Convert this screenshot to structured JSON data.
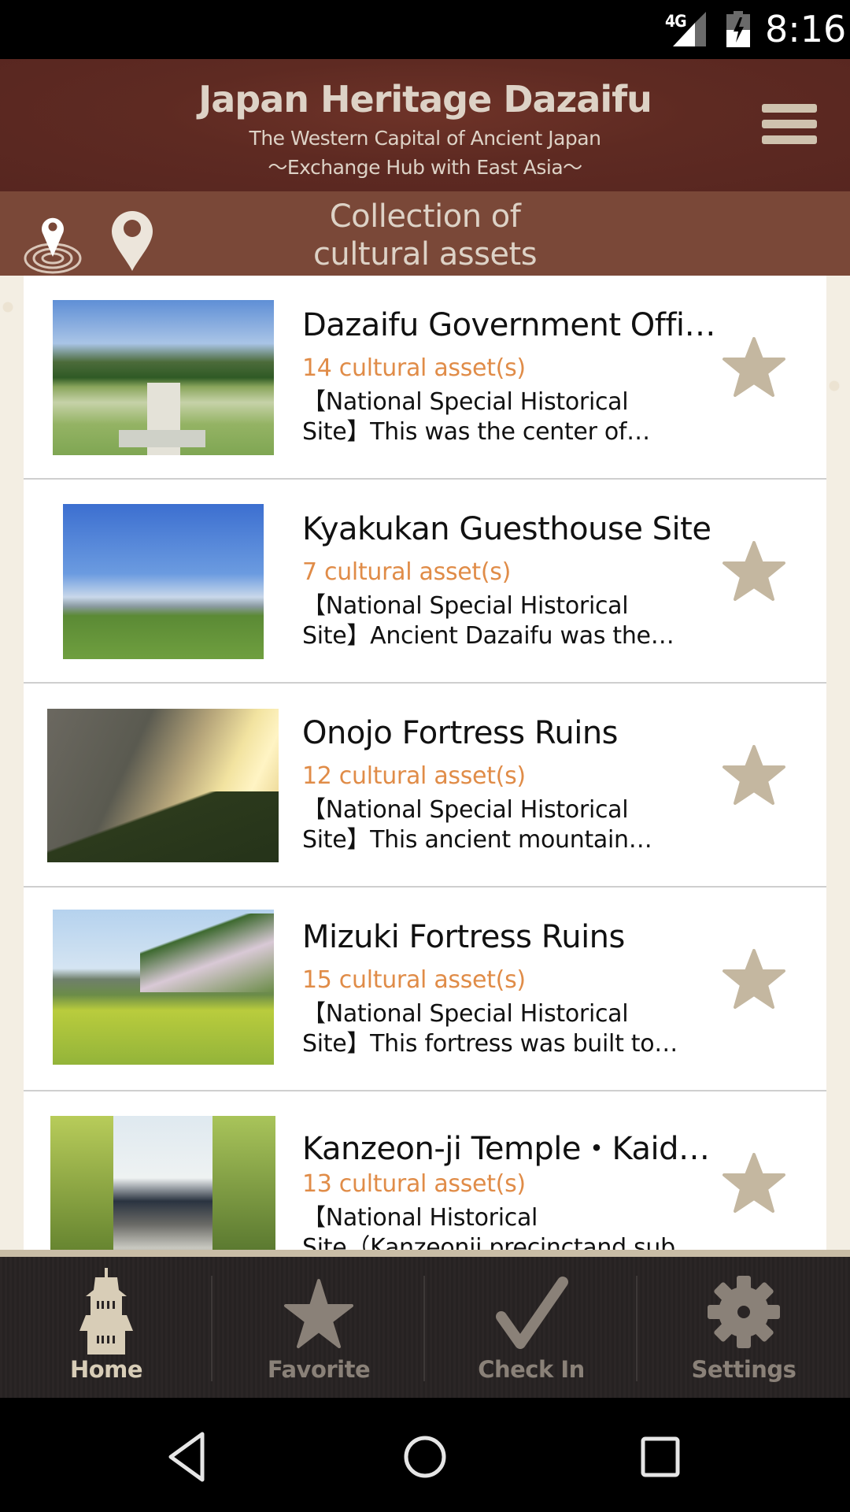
{
  "status_bar": {
    "network": "4G",
    "time": "8:16",
    "icons": [
      "signal-icon",
      "battery-charging-icon"
    ]
  },
  "header": {
    "title": "Japan Heritage Dazaifu",
    "subtitle_line1": "The Western Capital of Ancient Japan",
    "subtitle_line2": "〜Exchange Hub with East Asia〜",
    "menu_icon": "hamburger-menu-icon"
  },
  "sub_header": {
    "caption_line1": "Collection of",
    "caption_line2": "cultural assets",
    "left_icons": [
      "nearby-location-icon",
      "map-pin-icon"
    ]
  },
  "list": {
    "items": [
      {
        "name": "Dazaifu Government Offic…",
        "count": "14 cultural asset(s)",
        "desc_line1": "【National Special Historical",
        "desc_line2": "Site】This was the center of…",
        "favorite": false
      },
      {
        "name": "Kyakukan Guesthouse Site",
        "count": "7 cultural asset(s)",
        "desc_line1": "【National Special Historical",
        "desc_line2": "Site】Ancient Dazaifu was the…",
        "favorite": false
      },
      {
        "name": "Onojo Fortress Ruins",
        "count": "12 cultural asset(s)",
        "desc_line1": "【National Special Historical",
        "desc_line2": "Site】This ancient mountain…",
        "favorite": false
      },
      {
        "name": "Mizuki Fortress Ruins",
        "count": "15 cultural asset(s)",
        "desc_line1": "【National Special Historical",
        "desc_line2": "Site】This fortress was built to…",
        "favorite": false
      },
      {
        "name": "Kanzeon-ji Temple・Kaid…",
        "count": "13 cultural asset(s)",
        "desc_line1": "【National Historical",
        "desc_line2": "Site（Kanzeonji precinctand sub",
        "favorite": false
      }
    ]
  },
  "bottom_nav": {
    "tabs": [
      {
        "label": "Home",
        "icon": "pagoda-icon",
        "active": true
      },
      {
        "label": "Favorite",
        "icon": "star-icon",
        "active": false
      },
      {
        "label": "Check In",
        "icon": "checkmark-icon",
        "active": false
      },
      {
        "label": "Settings",
        "icon": "gear-icon",
        "active": false
      }
    ]
  },
  "system_nav": [
    "back-icon",
    "home-circle-icon",
    "recents-icon"
  ],
  "colors": {
    "header_bg": "#5e2a22",
    "subheader_bg": "#7a4838",
    "accent_count": "#e08c48",
    "star": "#c4b7a0",
    "nav_bg": "#2a2525",
    "nav_active": "#d8cdb7",
    "nav_inactive": "#8a8178"
  }
}
